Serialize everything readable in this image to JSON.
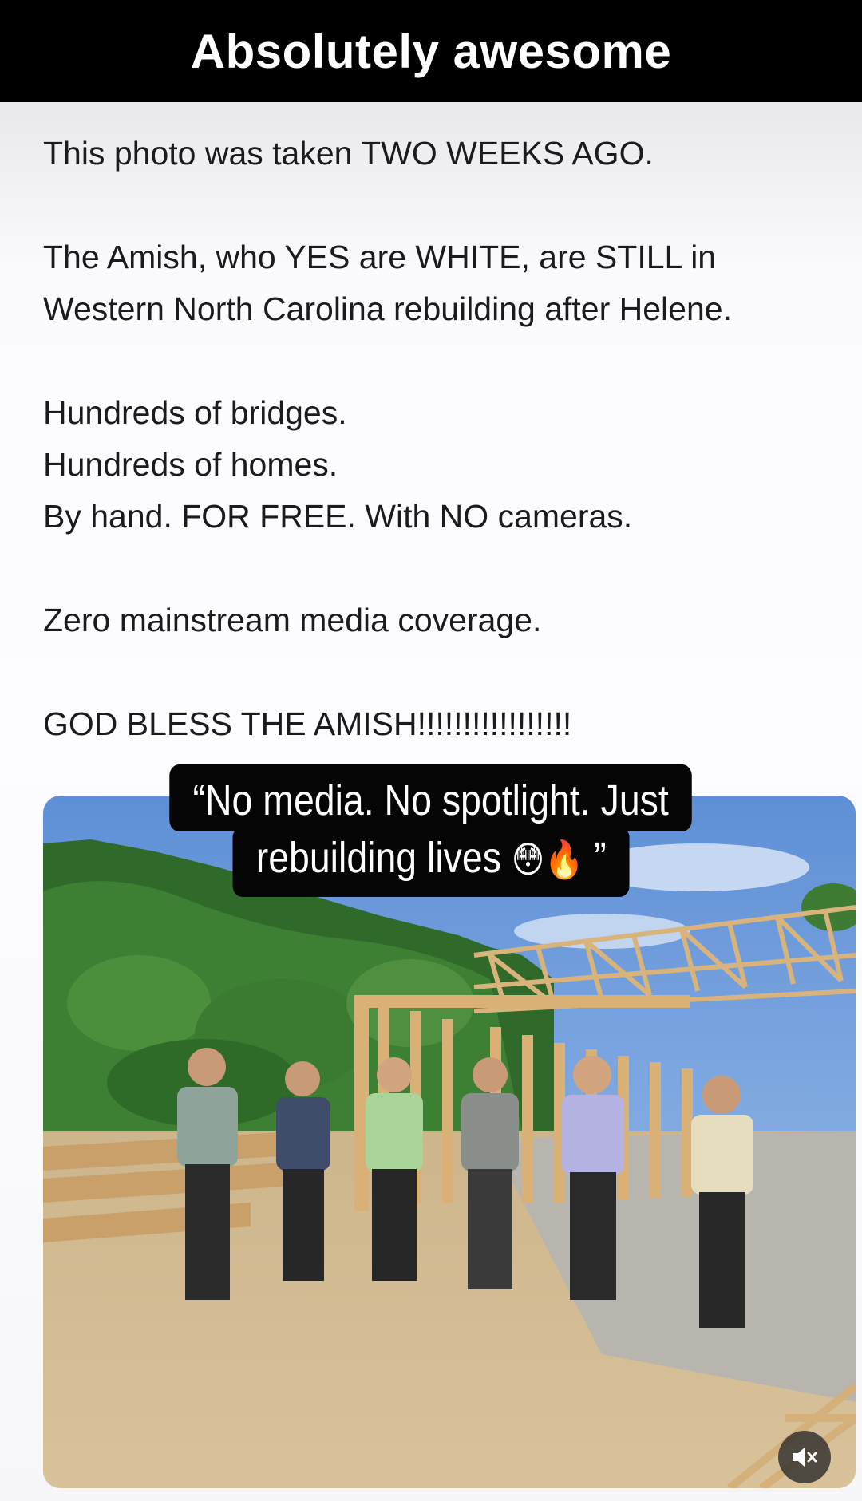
{
  "banner": {
    "title": "Absolutely awesome"
  },
  "post": {
    "lines": [
      "This photo was taken TWO WEEKS AGO.",
      "The Amish, who YES are WHITE, are STILL in",
      "Western North Carolina rebuilding after Helene.",
      "Hundreds of bridges.",
      "Hundreds of homes.",
      "By hand. FOR FREE. With NO cameras.",
      "Zero mainstream media coverage.",
      "GOD BLESS THE AMISH!!!!!!!!!!!!!!!!!"
    ]
  },
  "caption": {
    "line1": "“No media. No spotlight. Just",
    "line2": "rebuilding lives",
    "emojis": "😳🔥",
    "close_quote": "”"
  },
  "controls": {
    "mute_icon": "speaker-muted-icon"
  },
  "colors": {
    "banner_bg": "#000000",
    "banner_text": "#ffffff",
    "caption_bg": "#050505"
  }
}
